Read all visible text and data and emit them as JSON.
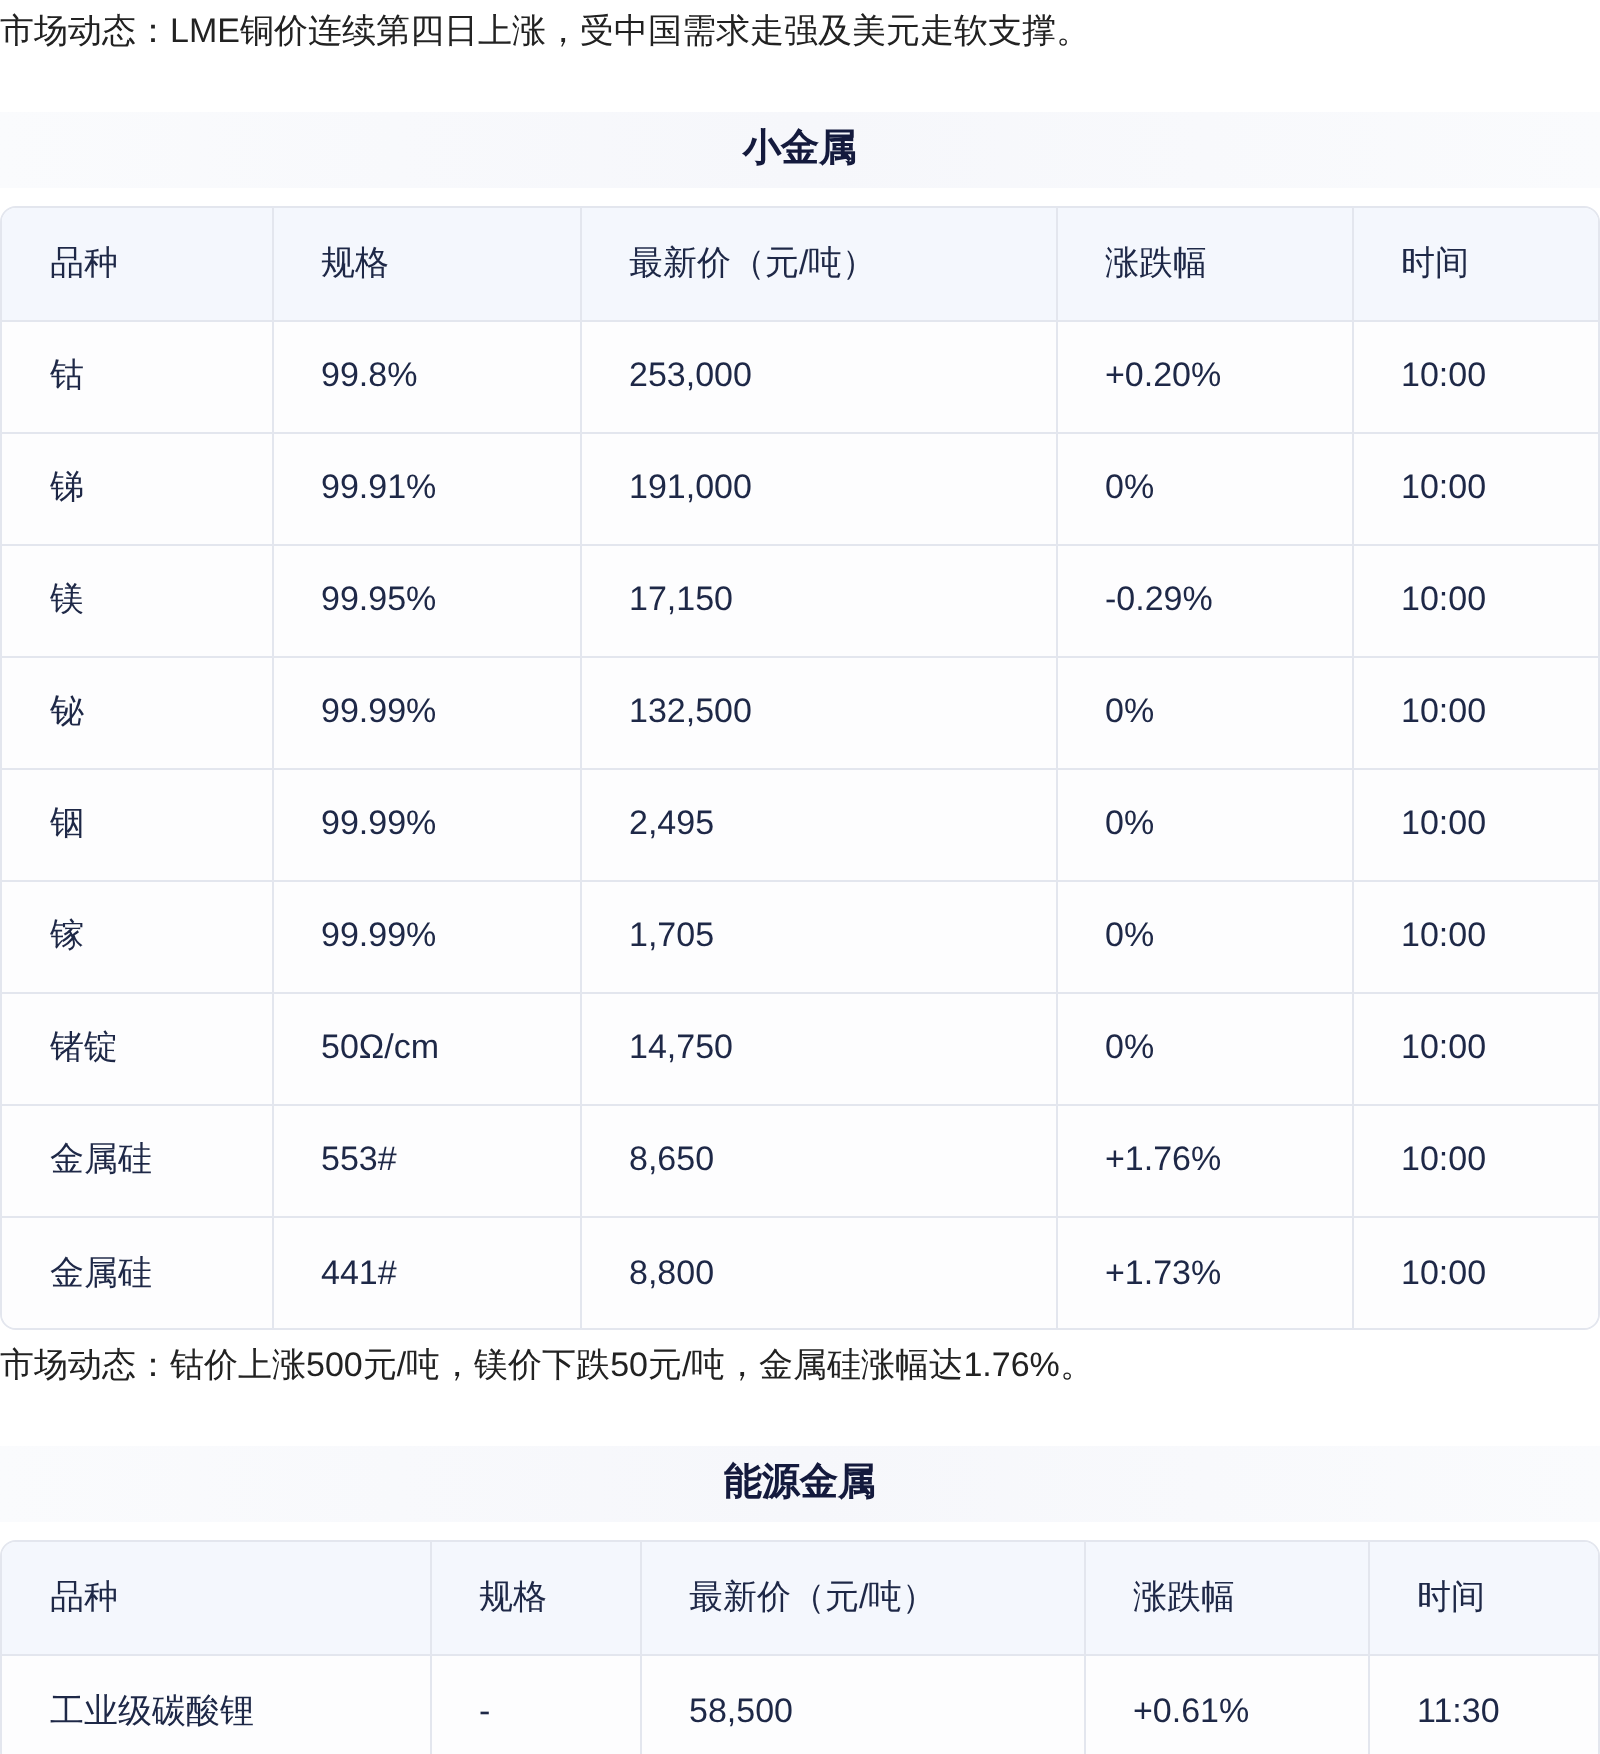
{
  "sections": [
    {
      "note": "市场动态：LME铜价连续第四日上涨，受中国需求走强及美元走软支撑。",
      "title": "小金属",
      "columns": [
        "品种",
        "规格",
        "最新价（元/吨）",
        "涨跌幅",
        "时间"
      ],
      "rows": [
        [
          "钴",
          "99.8%",
          "253,000",
          "+0.20%",
          "10:00"
        ],
        [
          "锑",
          "99.91%",
          "191,000",
          "0%",
          "10:00"
        ],
        [
          "镁",
          "99.95%",
          "17,150",
          "-0.29%",
          "10:00"
        ],
        [
          "铋",
          "99.99%",
          "132,500",
          "0%",
          "10:00"
        ],
        [
          "铟",
          "99.99%",
          "2,495",
          "0%",
          "10:00"
        ],
        [
          "镓",
          "99.99%",
          "1,705",
          "0%",
          "10:00"
        ],
        [
          "锗锭",
          "50Ω/cm",
          "14,750",
          "0%",
          "10:00"
        ],
        [
          "金属硅",
          "553#",
          "8,650",
          "+1.76%",
          "10:00"
        ],
        [
          "金属硅",
          "441#",
          "8,800",
          "+1.73%",
          "10:00"
        ]
      ]
    },
    {
      "note": "市场动态：钴价上涨500元/吨，镁价下跌50元/吨，金属硅涨幅达1.76%。",
      "title": "能源金属",
      "columns": [
        "品种",
        "规格",
        "最新价（元/吨）",
        "涨跌幅",
        "时间"
      ],
      "rows": [
        [
          "工业级碳酸锂",
          "-",
          "58,500",
          "+0.61%",
          "11:30"
        ]
      ]
    }
  ]
}
